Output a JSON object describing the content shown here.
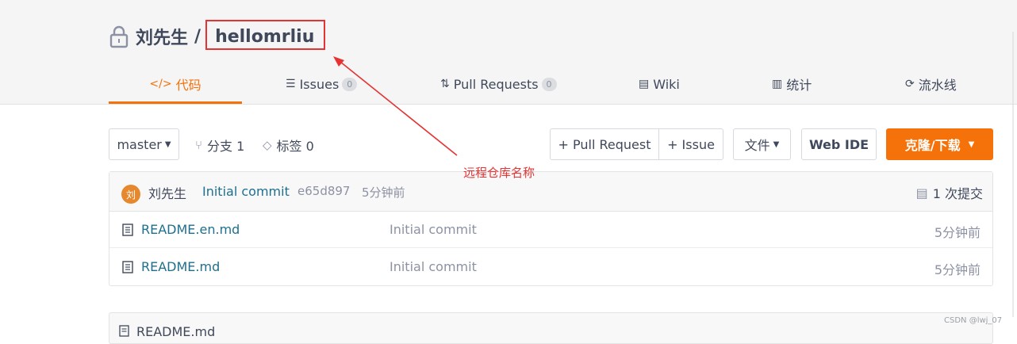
{
  "repo": {
    "owner": "刘先生",
    "separator": "/",
    "name": "hellomrliu"
  },
  "tabs": [
    {
      "icon": "</>",
      "label": "代码",
      "active": true
    },
    {
      "icon": "☰",
      "label": "Issues",
      "count": "0"
    },
    {
      "icon": "⇅",
      "label": "Pull Requests",
      "count": "0"
    },
    {
      "icon": "▤",
      "label": "Wiki"
    },
    {
      "icon": "▥",
      "label": "统计"
    },
    {
      "icon": "⟳",
      "label": "流水线"
    }
  ],
  "toolbar": {
    "branch": "master",
    "branches_label": "分支 1",
    "tags_label": "标签 0",
    "pull_request_label": "+ Pull Request",
    "issue_label": "+ Issue",
    "file_label": "文件",
    "web_ide_label": "Web IDE",
    "clone_label": "克隆/下载"
  },
  "commit": {
    "avatar_text": "刘",
    "author": "刘先生",
    "message": "Initial commit",
    "sha": "e65d897",
    "time": "5分钟前",
    "count_label": "1 次提交"
  },
  "files": [
    {
      "name": "README.en.md",
      "message": "Initial commit",
      "time": "5分钟前"
    },
    {
      "name": "README.md",
      "message": "Initial commit",
      "time": "5分钟前"
    }
  ],
  "readme": {
    "title": "README.md"
  },
  "annotation": {
    "text": "远程仓库名称"
  },
  "watermark": "CSDN @lwj_07",
  "colors": {
    "accent": "#f5720a",
    "annotation_red": "#e53333",
    "link": "#1e6f8d"
  }
}
